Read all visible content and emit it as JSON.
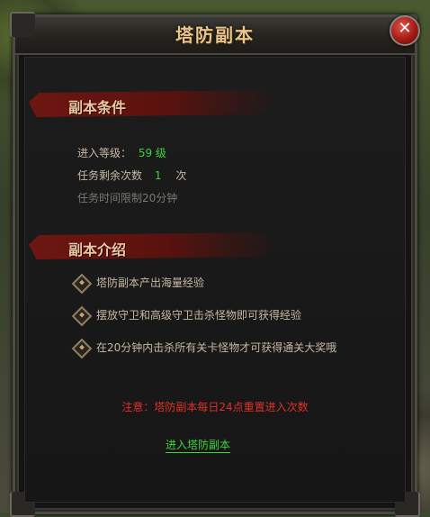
{
  "window": {
    "title": "塔防副本"
  },
  "conditions": {
    "header": "副本条件",
    "level_label": "进入等级：",
    "level_value": "59 级",
    "remaining_label": "任务剩余次数",
    "remaining_value": "1",
    "remaining_unit": "次",
    "time_limit": "任务时间限制20分钟"
  },
  "intro": {
    "header": "副本介绍",
    "items": [
      "塔防副本产出海量经验",
      "摆放守卫和高级守卫击杀怪物即可获得经验",
      "在20分钟内击杀所有关卡怪物才可获得通关大奖哦"
    ]
  },
  "notice": "注意：塔防副本每日24点重置进入次数",
  "enter_link": "进入塔防副本",
  "colors": {
    "accent_red": "#e0312a",
    "accent_green": "#3ed43e",
    "gold": "#e8c58a"
  }
}
